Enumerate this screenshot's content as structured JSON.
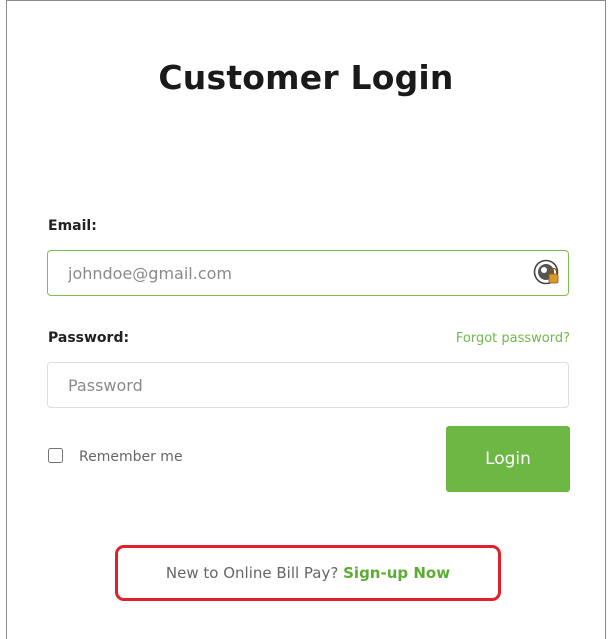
{
  "page": {
    "title": "Customer Login"
  },
  "form": {
    "email_label": "Email:",
    "email_placeholder": "johndoe@gmail.com",
    "password_label": "Password:",
    "password_placeholder": "Password",
    "forgot_password_link": "Forgot password?",
    "remember_me_label": "Remember me",
    "remember_me_checked": false,
    "login_button": "Login"
  },
  "signup": {
    "prompt": "New to Online Bill Pay?",
    "link": "Sign-up Now"
  },
  "colors": {
    "accent_green": "#6db844",
    "link_green": "#72b84a",
    "highlight_red": "#e0202a"
  },
  "icons": {
    "email_field_icon": "password-manager-icon"
  }
}
